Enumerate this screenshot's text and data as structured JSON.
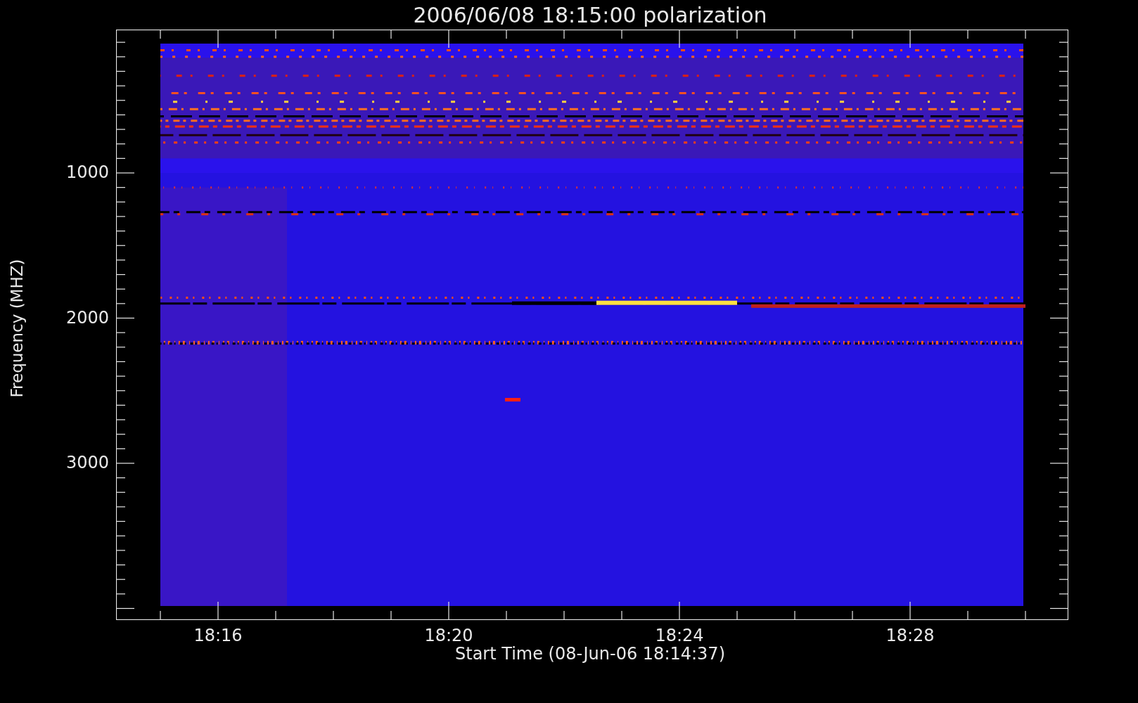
{
  "plot": {
    "title": "2006/06/08 18:15:00 polarization",
    "y_axis": {
      "label": "Frequency (MHZ)",
      "ticks": [
        "1000",
        "2000",
        "3000"
      ]
    },
    "x_axis": {
      "label": "Start Time (08-Jun-06 18:14:37)",
      "ticks": [
        "18:16",
        "18:20",
        "18:24",
        "18:28"
      ]
    }
  }
}
